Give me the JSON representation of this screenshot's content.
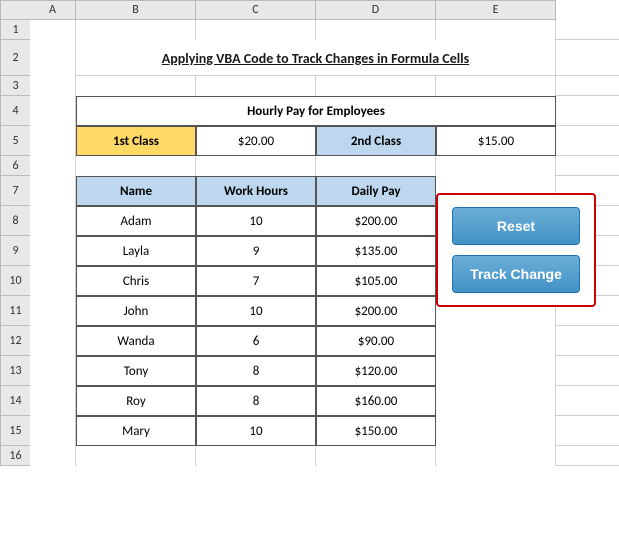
{
  "title": "Applying VBA Code to Track Changes in Formula Cells",
  "columns": [
    "A",
    "B",
    "C",
    "D",
    "E"
  ],
  "rows": [
    1,
    2,
    3,
    4,
    5,
    6,
    7,
    8,
    9,
    10,
    11,
    12,
    13,
    14,
    15,
    16
  ],
  "hourly_table": {
    "header": "Hourly Pay for Employees",
    "rows": [
      {
        "label": "1st Class",
        "value1": "$20.00",
        "label2": "2nd Class",
        "value2": "$15.00"
      }
    ]
  },
  "employee_table": {
    "headers": [
      "Name",
      "Work Hours",
      "Daily Pay"
    ],
    "rows": [
      {
        "name": "Adam",
        "hours": "10",
        "pay": "$200.00"
      },
      {
        "name": "Layla",
        "hours": "9",
        "pay": "$135.00"
      },
      {
        "name": "Chris",
        "hours": "7",
        "pay": "$105.00"
      },
      {
        "name": "John",
        "hours": "10",
        "pay": "$200.00"
      },
      {
        "name": "Wanda",
        "hours": "6",
        "pay": "$90.00"
      },
      {
        "name": "Tony",
        "hours": "8",
        "pay": "$120.00"
      },
      {
        "name": "Roy",
        "hours": "8",
        "pay": "$160.00"
      },
      {
        "name": "Mary",
        "hours": "10",
        "pay": "$150.00"
      }
    ]
  },
  "buttons": {
    "reset_label": "Reset",
    "track_change_label": "Track Change"
  },
  "colors": {
    "accent_blue": "#4292c6",
    "border_red": "#cc0000",
    "cell_yellow": "#FFD966",
    "emp_header_blue": "#BDD7EE",
    "hourly_header_bg": "#ffffff"
  }
}
